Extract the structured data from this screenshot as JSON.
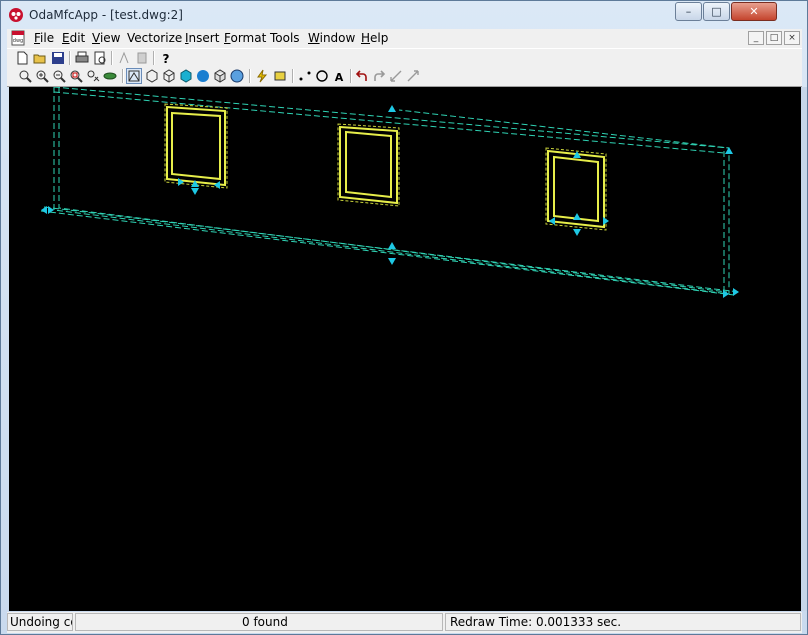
{
  "window": {
    "title": "OdaMfcApp - [test.dwg:2]",
    "minimize_label": "–",
    "maximize_label": "□",
    "close_label": "✕"
  },
  "menubar": {
    "items": [
      {
        "mnemonic": "F",
        "rest": "ile"
      },
      {
        "mnemonic": "E",
        "rest": "dit"
      },
      {
        "mnemonic": "V",
        "rest": "iew"
      },
      {
        "mnemonic": "",
        "rest": "Vectorize"
      },
      {
        "mnemonic": "I",
        "rest": "nsert"
      },
      {
        "mnemonic": "F",
        "rest": "ormat"
      },
      {
        "mnemonic": "",
        "rest": "Tools"
      },
      {
        "mnemonic": "W",
        "rest": "indow"
      },
      {
        "mnemonic": "H",
        "rest": "elp"
      }
    ],
    "mdi_buttons": [
      "_",
      "□",
      "×"
    ]
  },
  "toolbar": {
    "file_icons": [
      "new-file-icon",
      "open-folder-icon",
      "save-disk-icon",
      "print-icon",
      "print-preview-icon",
      "cut-disabled-icon",
      "paste-disabled-icon",
      "help-icon"
    ],
    "view_icons": [
      "zoom-window-icon",
      "zoom-in-icon",
      "zoom-out-icon",
      "zoom-extents-icon",
      "pan-icon",
      "orbit-icon",
      "2d-wireframe-icon",
      "3d-wireframe-icon",
      "hidden-line-icon",
      "flat-shaded-icon",
      "gouraud-shaded-icon",
      "flat-shaded-edges-icon",
      "gouraud-shaded-edges-icon",
      "lightning-icon",
      "render-icon",
      "point-icon",
      "circle-icon",
      "text-icon",
      "undo-icon",
      "redo-icon",
      "line-icon",
      "ray-icon"
    ]
  },
  "statusbar": {
    "message": "Undoing cor",
    "found": "0 found",
    "redraw_time": "Redraw Time: 0.001333 sec."
  },
  "colors": {
    "canvas_bg": "#000000",
    "dashed_lines": "#2fd3b4",
    "frame_yellow": "#e7ee4a",
    "grip_cyan": "#1ec8e4"
  }
}
